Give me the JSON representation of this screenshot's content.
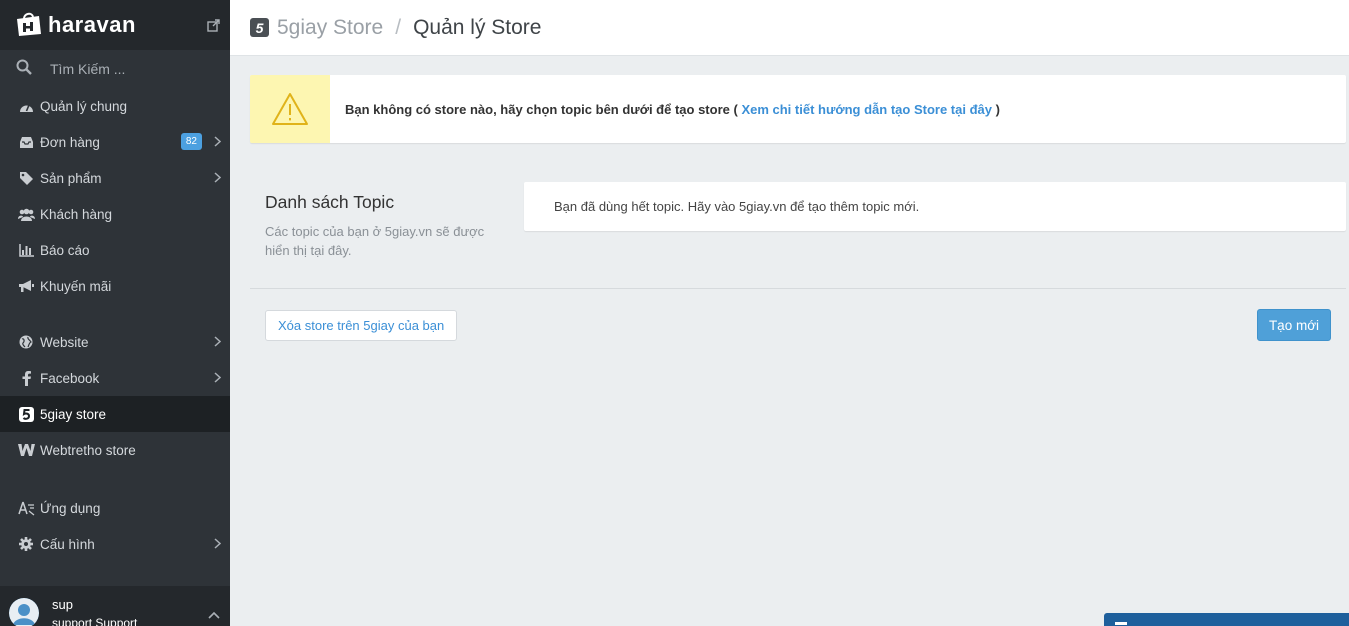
{
  "sidebar": {
    "brand": "haravan",
    "search_placeholder": "Tìm Kiếm ...",
    "items": [
      {
        "label": "Quản lý chung",
        "icon": "dashboard-icon"
      },
      {
        "label": "Đơn hàng",
        "icon": "inbox-icon",
        "badge": "82"
      },
      {
        "label": "Sản phẩm",
        "icon": "tag-icon"
      },
      {
        "label": "Khách hàng",
        "icon": "users-icon"
      },
      {
        "label": "Báo cáo",
        "icon": "bar-chart-icon"
      },
      {
        "label": "Khuyến mãi",
        "icon": "megaphone-icon"
      },
      {
        "label": "Website",
        "icon": "globe-icon"
      },
      {
        "label": "Facebook",
        "icon": "facebook-icon"
      },
      {
        "label": "5giay store",
        "icon": "5giay-icon"
      },
      {
        "label": "Webtretho store",
        "icon": "webtretho-icon"
      },
      {
        "label": "Ứng dụng",
        "icon": "app-icon"
      },
      {
        "label": "Cấu hình",
        "icon": "gear-icon"
      }
    ],
    "user": {
      "name": "sup",
      "role": "support Support"
    }
  },
  "header": {
    "store": "5giay Store",
    "separator": "/",
    "page": "Quản lý Store"
  },
  "alert": {
    "text": "Bạn không có store nào, hãy chọn topic bên dưới để tạo store (",
    "link": "Xem chi tiết hướng dẫn tạo Store tại đây",
    "close_paren": ")"
  },
  "topics": {
    "title": "Danh sách Topic",
    "description": "Các topic của bạn ở 5giay.vn sẽ được hiển thị tại đây.",
    "empty_message": "Bạn đã dùng hết topic. Hãy vào 5giay.vn để tạo thêm topic mới."
  },
  "actions": {
    "delete_label": "Xóa store trên 5giay của bạn",
    "create_label": "Tạo mới"
  },
  "colors": {
    "sidebar_bg": "#2e3338",
    "accent": "#4fa0d8",
    "alert_icon_bg": "#fdf6b1",
    "link": "#3b8fd6"
  }
}
